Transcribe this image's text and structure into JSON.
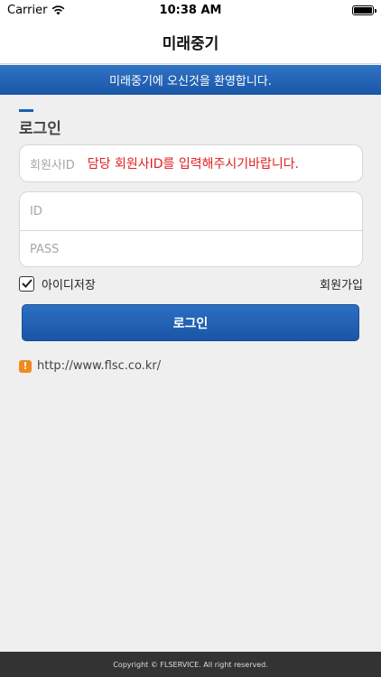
{
  "status_bar": {
    "carrier": "Carrier",
    "time": "10:38 AM",
    "wifi_icon": "wifi-icon",
    "battery_icon": "battery-icon"
  },
  "nav": {
    "title": "미래중기"
  },
  "banner": {
    "text": "미래중기에 오신것을 환영합니다."
  },
  "login": {
    "heading": "로그인",
    "company_id_placeholder": "회원사ID",
    "company_id_hint": "담당 회원사ID를 입력해주시기바랍니다.",
    "id_placeholder": "ID",
    "pass_placeholder": "PASS",
    "remember_label": "아이디저장",
    "remember_checked": true,
    "signup_label": "회원가입",
    "login_button_label": "로그인"
  },
  "info": {
    "url": "http://www.flsc.co.kr/",
    "icon": "warning-icon"
  },
  "footer": {
    "copyright": "Copyright © FLSERVICE. All right reserved."
  },
  "colors": {
    "accent": "#1a56a8",
    "hint_red": "#e02020",
    "warning_orange": "#f08a1c",
    "footer_bg": "#333333"
  }
}
